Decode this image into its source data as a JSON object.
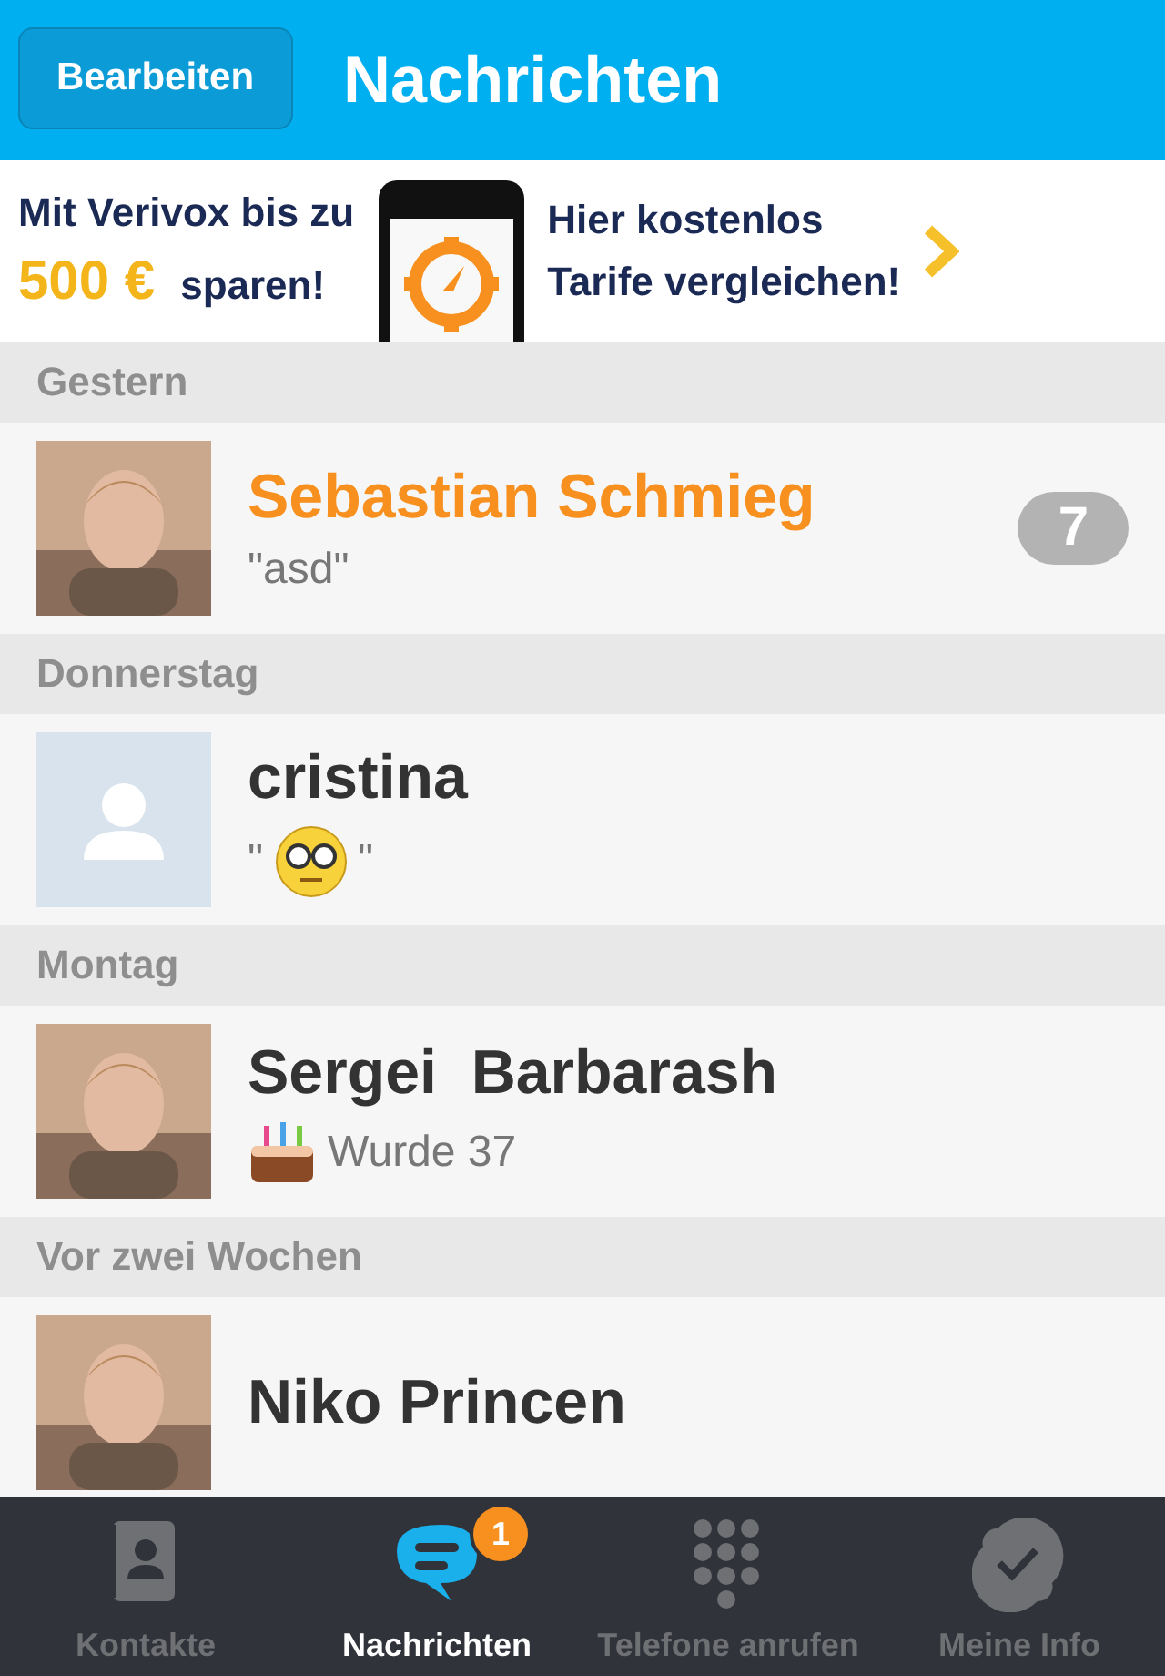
{
  "header": {
    "edit_button": "Bearbeiten",
    "title": "Nachrichten"
  },
  "ad": {
    "line_1": "Mit Verivox bis zu",
    "amount": "500 €",
    "line_2": "sparen!",
    "line_3": "Hier kostenlos",
    "line_4": "Tarife vergleichen!"
  },
  "groups": [
    {
      "label": "Gestern",
      "conversations": [
        {
          "name": "Sebastian Schmieg",
          "unread": true,
          "kind": "text",
          "message": "\"asd\"",
          "count": "7"
        }
      ]
    },
    {
      "label": "Donnerstag",
      "conversations": [
        {
          "name": "cristina",
          "unread": false,
          "avatar": {
            "kind": "placeholder"
          },
          "kind": "emoji",
          "quote_open": "\"",
          "quote_close": "\""
        }
      ]
    },
    {
      "label": "Montag",
      "conversations": [
        {
          "name": "Sergei  Barbarash",
          "unread": false,
          "kind": "birthday",
          "message": "Wurde 37"
        }
      ]
    },
    {
      "label": "Vor zwei Wochen",
      "conversations": [
        {
          "name": "Niko Princen",
          "unread": false,
          "kind": "text"
        }
      ]
    }
  ],
  "tabs": [
    {
      "label": "Kontakte",
      "kind": "contacts",
      "selected": false
    },
    {
      "label": "Nachrichten",
      "kind": "chat",
      "selected": true,
      "badge": "1"
    },
    {
      "label": "Telefone anrufen",
      "kind": "dialpad",
      "selected": false
    },
    {
      "label": "Meine Info",
      "kind": "check",
      "selected": false
    }
  ]
}
